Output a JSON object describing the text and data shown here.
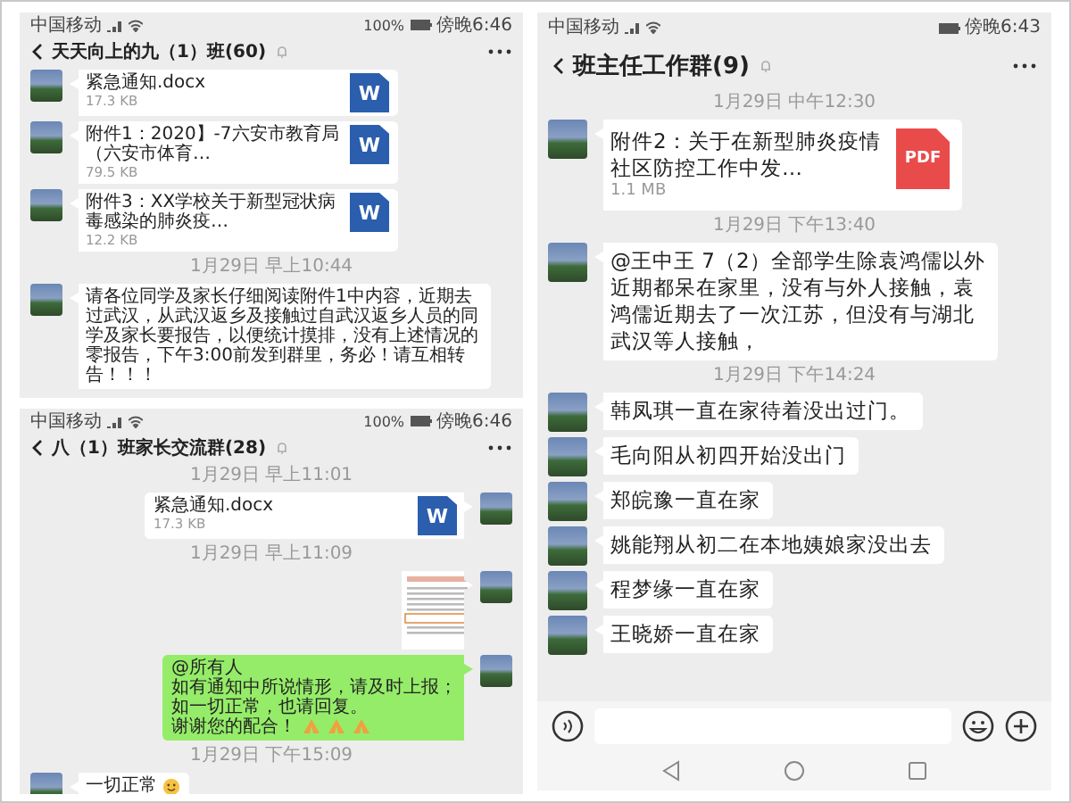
{
  "panels": [
    {
      "status_bar": {
        "carrier": "中国移动",
        "battery": "100%",
        "time": "傍晚6:46"
      },
      "header": {
        "title": "天天向上的九（1）班(60)"
      },
      "messages": [
        {
          "kind": "file",
          "outgoing": false,
          "name": "紧急通知.docx",
          "size": "17.3 KB",
          "file_icon": {
            "kind": "word",
            "label": "W"
          }
        },
        {
          "kind": "file",
          "outgoing": false,
          "name": "附件1：2020】-7六安市教育局（六安市体育…",
          "size": "79.5 KB",
          "file_icon": {
            "kind": "word",
            "label": "W"
          }
        },
        {
          "kind": "file",
          "outgoing": false,
          "name": "附件3：XX学校关于新型冠状病毒感染的肺炎疫…",
          "size": "12.2 KB",
          "file_icon": {
            "kind": "word",
            "label": "W"
          }
        },
        {
          "kind": "time",
          "text": "1月29日 早上10:44"
        },
        {
          "kind": "text",
          "outgoing": false,
          "lines": [
            "请各位同学及家长仔细阅读附件1中内容，近期去过武汉，从武汉返乡及接触过自武汉返乡人员的同学及家长要报告，以便统计摸排，没有上述情况的零报告，下午3:00前发到群里，务必！请互相转告！！！"
          ]
        }
      ]
    },
    {
      "status_bar": {
        "carrier": "中国移动",
        "battery": "100%",
        "time": "傍晚6:46"
      },
      "header": {
        "title": "八（1）班家长交流群(28)"
      },
      "messages": [
        {
          "kind": "time",
          "text": "1月29日 早上11:01"
        },
        {
          "kind": "file",
          "outgoing": true,
          "name": "紧急通知.docx",
          "size": "17.3 KB",
          "file_icon": {
            "kind": "word",
            "label": "W"
          }
        },
        {
          "kind": "time",
          "text": "1月29日 早上11:09"
        },
        {
          "kind": "image",
          "outgoing": true
        },
        {
          "kind": "text",
          "outgoing": true,
          "lines": [
            "@所有人",
            "如有通知中所说情形，请及时上报；",
            "如一切正常，也请回复。",
            "谢谢您的配合！"
          ],
          "icons": [
            {
              "kind": "bow"
            },
            {
              "kind": "bow"
            },
            {
              "kind": "bow"
            }
          ]
        },
        {
          "kind": "time",
          "text": "1月29日 下午15:09"
        },
        {
          "kind": "text",
          "outgoing": false,
          "lines": [
            "一切正常"
          ],
          "icons": [
            {
              "kind": "smile"
            }
          ]
        }
      ]
    },
    {
      "status_bar": {
        "carrier": "中国移动",
        "time": "傍晚6:43"
      },
      "header": {
        "title": "班主任工作群(9)"
      },
      "input_bar": true,
      "messages": [
        {
          "kind": "time",
          "text": "1月29日 中午12:30"
        },
        {
          "kind": "file",
          "outgoing": false,
          "name": "附件2：关于在新型肺炎疫情社区防控工作中发…",
          "size": "1.1 MB",
          "file_icon": {
            "kind": "pdf",
            "label": "PDF"
          }
        },
        {
          "kind": "time",
          "text": "1月29日 下午13:40"
        },
        {
          "kind": "text",
          "outgoing": false,
          "lines": [
            "@王中王 7（2）全部学生除袁鸿儒以外近期都呆在家里，没有与外人接触，袁鸿儒近期去了一次江苏，但没有与湖北武汉等人接触，"
          ]
        },
        {
          "kind": "time",
          "text": "1月29日 下午14:24"
        },
        {
          "kind": "text",
          "outgoing": false,
          "lines": [
            "韩凤琪一直在家待着没出过门。"
          ]
        },
        {
          "kind": "text",
          "outgoing": false,
          "lines": [
            "毛向阳从初四开始没出门"
          ]
        },
        {
          "kind": "text",
          "outgoing": false,
          "lines": [
            "郑皖豫一直在家"
          ]
        },
        {
          "kind": "text",
          "outgoing": false,
          "lines": [
            "姚能翔从初二在本地姨娘家没出去"
          ]
        },
        {
          "kind": "text",
          "outgoing": false,
          "lines": [
            "程梦缘一直在家"
          ]
        },
        {
          "kind": "text",
          "outgoing": false,
          "lines": [
            "王晓娇一直在家"
          ]
        }
      ]
    }
  ]
}
